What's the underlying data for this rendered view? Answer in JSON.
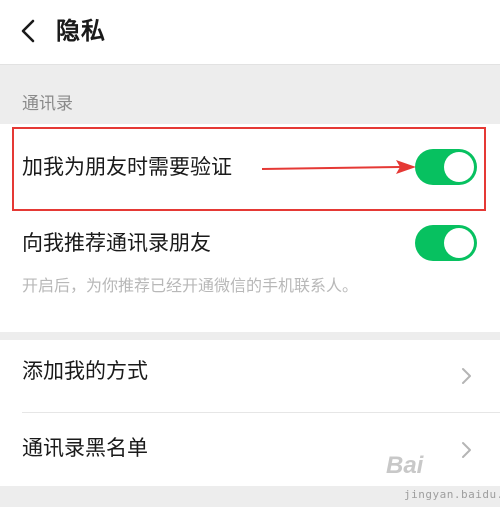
{
  "header": {
    "title": "隐私",
    "back_icon": "chevron-left-icon"
  },
  "section": {
    "label": "通讯录"
  },
  "settings": {
    "friend_verification": {
      "label": "加我为朋友时需要验证",
      "enabled": true
    },
    "recommend_contacts": {
      "label": "向我推荐通讯录朋友",
      "enabled": true,
      "description": "开启后，为你推荐已经开通微信的手机联系人。"
    },
    "add_me_methods": {
      "label": "添加我的方式"
    },
    "contacts_blacklist": {
      "label": "通讯录黑名单"
    }
  },
  "annotation": {
    "color": "#e53935"
  },
  "colors": {
    "toggle_on": "#07c160",
    "background": "#ededed"
  },
  "watermark": {
    "brand": "Bai",
    "url": "jingyan.baidu.com"
  }
}
